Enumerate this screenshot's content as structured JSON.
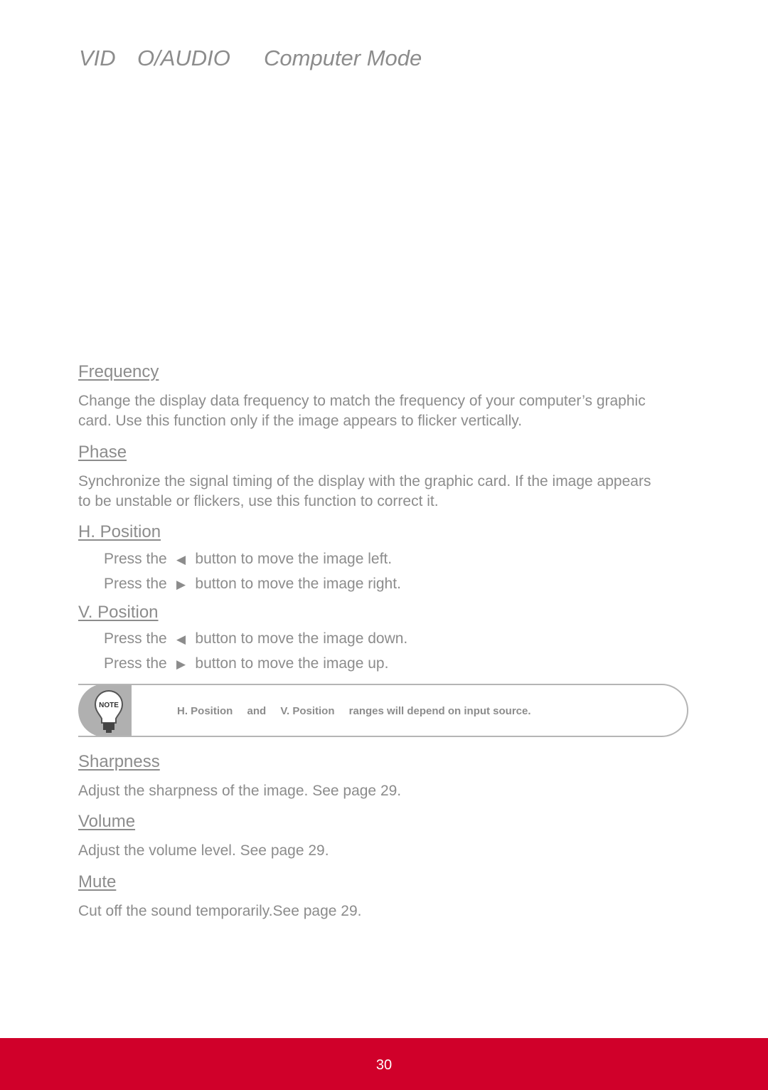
{
  "header": {
    "part1": "VID",
    "part2": "O/AUDIO",
    "part3": "Computer Mode"
  },
  "sections": [
    {
      "heading": "Frequency",
      "body": "Change the display data frequency to match the frequency of your computer’s graphic card. Use this function only if the image appears to flicker vertically."
    },
    {
      "heading": "Phase",
      "body": "Synchronize the signal timing of the display with the graphic card. If the image appears to be unstable or flickers, use this function to correct it."
    },
    {
      "heading": "H. Position",
      "lines": [
        {
          "pre": "Press the",
          "icon": "left-triangle-icon",
          "post": "button to move the image left."
        },
        {
          "pre": "Press the",
          "icon": "right-triangle-icon",
          "post": "button to move the image right."
        }
      ]
    },
    {
      "heading": "V. Position",
      "lines": [
        {
          "pre": "Press the",
          "icon": "left-triangle-icon",
          "post": "button to move the image down."
        },
        {
          "pre": "Press the",
          "icon": "right-triangle-icon",
          "post": "button to move the image up."
        }
      ]
    },
    {
      "heading": "Sharpness",
      "body": "Adjust the sharpness of the image. See page 29."
    },
    {
      "heading": "Volume",
      "body": "Adjust the volume level. See page 29."
    },
    {
      "heading": "Mute",
      "body": "Cut off the sound temporarily.See page 29."
    }
  ],
  "note": {
    "icon_label": "NOTE",
    "parts": [
      "H. Position",
      "and",
      "V. Position",
      "ranges will depend on input source."
    ]
  },
  "footer": {
    "page_number": "30",
    "color": "#d0002a"
  }
}
